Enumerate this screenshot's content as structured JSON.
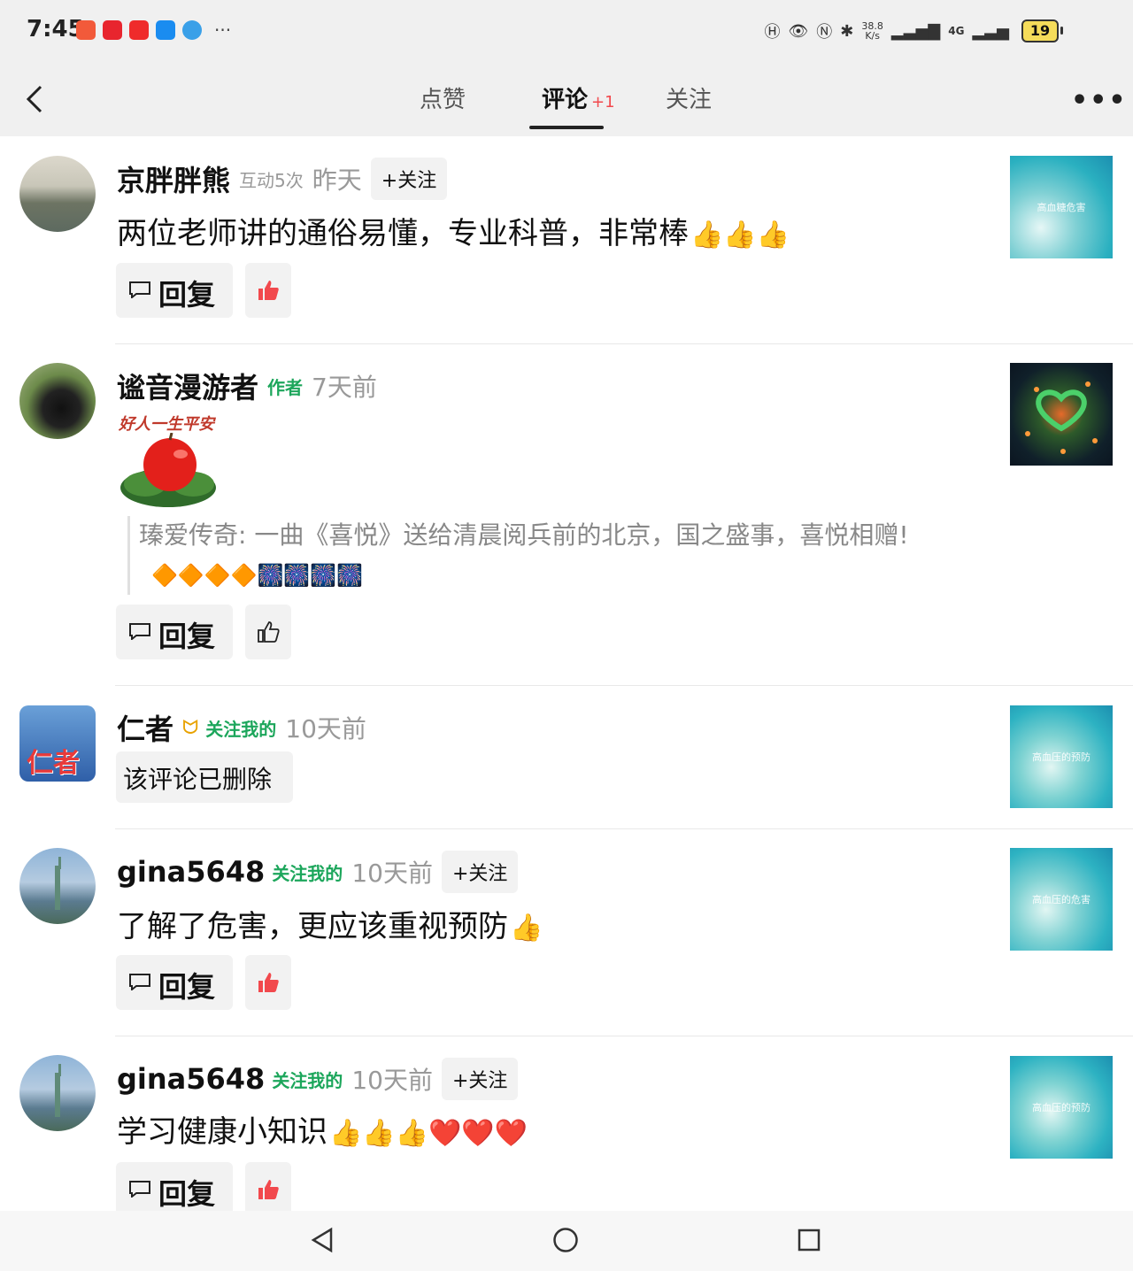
{
  "status_bar": {
    "time": "7:45",
    "net_speed": "38.8",
    "net_speed_unit": "K/s",
    "network": "4G",
    "battery": "19"
  },
  "nav": {
    "tabs": [
      {
        "label": "点赞"
      },
      {
        "label": "评论",
        "badge": "+1",
        "active": true
      },
      {
        "label": "关注"
      }
    ],
    "more": "•••"
  },
  "comments": [
    {
      "user": "京胖胖熊",
      "interaction": "互动5次",
      "time": "昨天",
      "follow": "+关注",
      "text": "两位老师讲的通俗易懂，专业科普，非常棒",
      "emoji": "👍👍👍",
      "reply": "回复",
      "liked": true,
      "thumb_text": "高血糖危害"
    },
    {
      "user": "谧音漫游者",
      "tag": "作者",
      "time": "7天前",
      "sticker_text": "好人一生平安",
      "quote": "瑧爱传奇: 一曲《喜悦》送给清晨阅兵前的北京，国之盛事，喜悦相赠!",
      "quote_emoji": "🔶🔶🔶🔶🎆🎆🎆🎆",
      "reply": "回复",
      "liked": false
    },
    {
      "user": "仁者",
      "avatar_text": "仁者",
      "tag": "关注我的",
      "time": "10天前",
      "deleted": "该评论已删除",
      "thumb_text": "高血压的预防"
    },
    {
      "user": "gina5648",
      "tag": "关注我的",
      "time": "10天前",
      "follow": "+关注",
      "text": "了解了危害，更应该重视预防",
      "emoji": "👍",
      "reply": "回复",
      "liked": true,
      "thumb_text": "高血压的危害"
    },
    {
      "user": "gina5648",
      "tag": "关注我的",
      "time": "10天前",
      "follow": "+关注",
      "text": "学习健康小知识",
      "emoji": "👍👍👍❤️❤️❤️",
      "reply": "回复",
      "liked": true,
      "thumb_text": "高血压的预防"
    }
  ],
  "colors": {
    "accent_green": "#1ca65b",
    "like_red": "#f2494d",
    "badge_red": "#f2494d"
  }
}
